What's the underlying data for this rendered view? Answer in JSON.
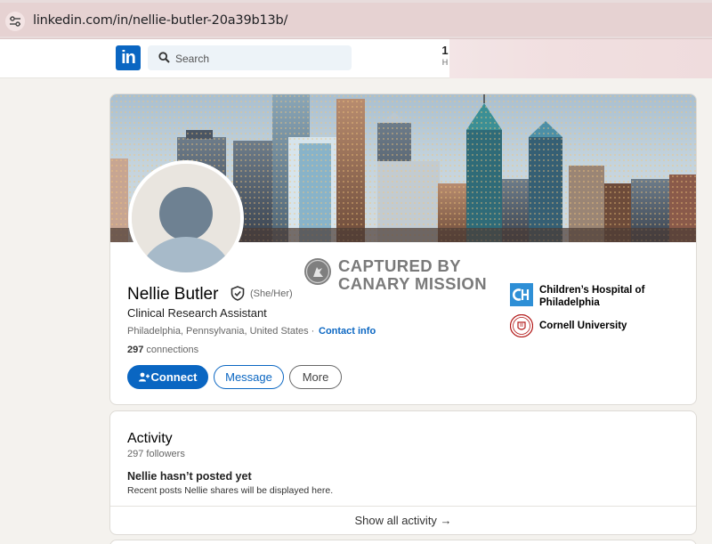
{
  "browser": {
    "url": "linkedin.com/in/nellie-butler-20a39b13b/",
    "site_info_icon": "tune-icon"
  },
  "nav": {
    "logo": "in",
    "search_placeholder": "Search",
    "item_count": "1",
    "item_label": "H"
  },
  "profile": {
    "name": "Nellie Butler",
    "pronouns": "(She/Her)",
    "headline": "Clinical Research Assistant",
    "location": "Philadelphia, Pennsylvania, United States ·",
    "contact_link": "Contact info",
    "connections_count": "297",
    "connections_label": "connections",
    "buttons": {
      "connect": "Connect",
      "message": "Message",
      "more": "More"
    },
    "organizations": [
      {
        "line1": "Children’s Hospital of",
        "line2": "Philadelphia",
        "icon": "chop-logo-icon"
      },
      {
        "line1": "Cornell University",
        "icon": "cornell-seal-icon"
      }
    ]
  },
  "watermark": {
    "line1": "CAPTURED BY",
    "line2": "CANARY MISSION"
  },
  "activity": {
    "title": "Activity",
    "followers": "297 followers",
    "empty_title": "Nellie hasn’t posted yet",
    "empty_desc": "Recent posts Nellie shares will be displayed here.",
    "show_all": "Show all activity →"
  },
  "colors": {
    "brand": "#0a66c2",
    "page_bg": "#f4f2ee",
    "url_bar_bg": "#e6d2d2"
  }
}
